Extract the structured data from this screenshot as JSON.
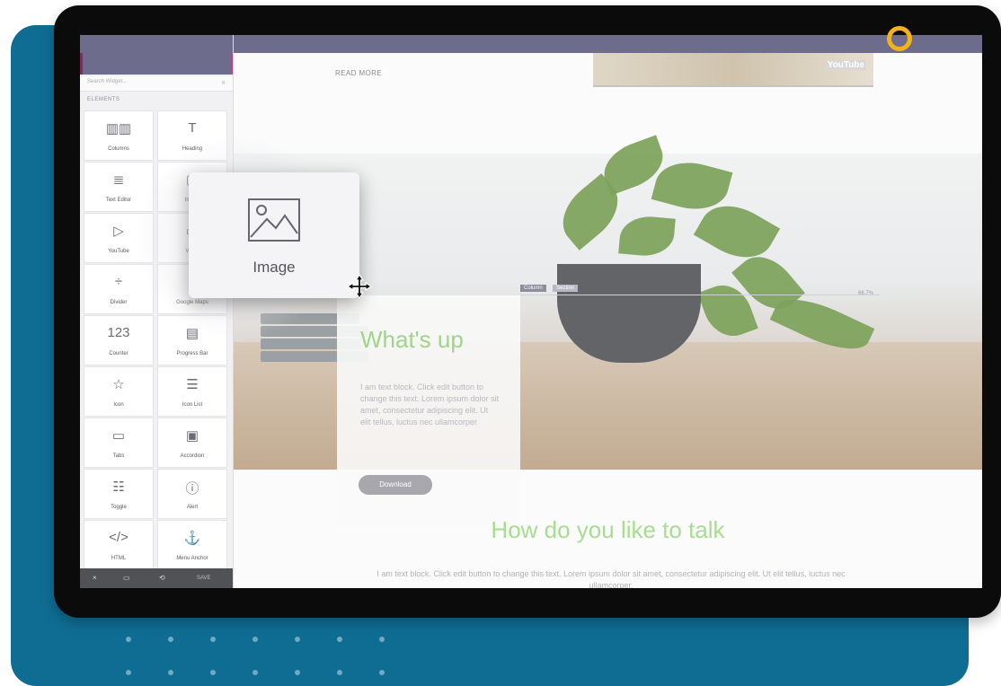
{
  "sidebar": {
    "search_placeholder": "Search Widget...",
    "section_label": "ELEMENTS",
    "widgets": [
      {
        "label": "Columns",
        "icon": "columns-icon",
        "glyph": "▥▥"
      },
      {
        "label": "Heading",
        "icon": "heading-icon",
        "glyph": "T"
      },
      {
        "label": "Text Editor",
        "icon": "text-editor-icon",
        "glyph": "≣"
      },
      {
        "label": "Image",
        "icon": "image-icon",
        "glyph": "▢"
      },
      {
        "label": "YouTube",
        "icon": "youtube-icon",
        "glyph": "▷"
      },
      {
        "label": "Video",
        "icon": "video-icon",
        "glyph": "▭"
      },
      {
        "label": "Divider",
        "icon": "divider-icon",
        "glyph": "÷"
      },
      {
        "label": "Google Maps",
        "icon": "map-pin-icon",
        "glyph": "⌖"
      },
      {
        "label": "Counter",
        "icon": "counter-icon",
        "glyph": "123"
      },
      {
        "label": "Progress Bar",
        "icon": "progress-bar-icon",
        "glyph": "▤"
      },
      {
        "label": "Icon",
        "icon": "star-icon",
        "glyph": "☆"
      },
      {
        "label": "Icon List",
        "icon": "icon-list-icon",
        "glyph": "☰"
      },
      {
        "label": "Tabs",
        "icon": "tabs-icon",
        "glyph": "▭"
      },
      {
        "label": "Accordion",
        "icon": "accordion-icon",
        "glyph": "▣"
      },
      {
        "label": "Toggle",
        "icon": "toggle-icon",
        "glyph": "☷"
      },
      {
        "label": "Alert",
        "icon": "alert-icon",
        "glyph": "ⓘ"
      },
      {
        "label": "HTML",
        "icon": "code-icon",
        "glyph": "</>"
      },
      {
        "label": "Menu Anchor",
        "icon": "anchor-icon",
        "glyph": "⚓"
      }
    ],
    "footer": {
      "close": "×",
      "save": "SAVE"
    }
  },
  "canvas": {
    "read_more": "READ MORE",
    "youtube_logo": "YouTube",
    "column_tag": "Column",
    "section_tag": "Section",
    "width_readout": "66.7%",
    "card": {
      "heading": "What's up",
      "body": "I am text block. Click edit button to change this text. Lorem ipsum dolor sit amet, consectetur adipiscing elit. Ut elit tellus, luctus nec ullamcorper",
      "button": "Download"
    },
    "talk_heading": "How do you like to talk",
    "talk_body": "I am text block. Click edit button to change this text. Lorem ipsum dolor sit amet, consectetur adipiscing elit. Ut elit tellus, luctus nec ullamcorper."
  },
  "drag_item": {
    "label": "Image",
    "icon": "image-icon"
  },
  "colors": {
    "backplate": "#0f6d93",
    "accent_ring": "#f3b21c",
    "editor_bar": "#6e6c8c",
    "heading_green": "#9fd58a"
  }
}
